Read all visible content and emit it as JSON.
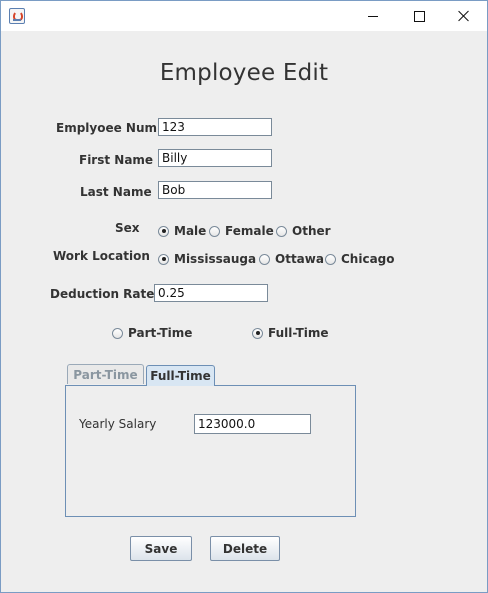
{
  "window": {
    "icon": "java-icon",
    "controls": {
      "minimize": "minimize-icon",
      "maximize": "maximize-icon",
      "close": "close-icon"
    }
  },
  "form": {
    "title": "Employee Edit",
    "employee_num": {
      "label": "Emplyoee Num",
      "value": "123"
    },
    "first_name": {
      "label": "First Name",
      "value": "Billy"
    },
    "last_name": {
      "label": "Last Name",
      "value": "Bob"
    },
    "sex": {
      "label": "Sex",
      "options": [
        "Male",
        "Female",
        "Other"
      ],
      "selected": "Male"
    },
    "work_location": {
      "label": "Work Location",
      "options": [
        "Mississauga",
        "Ottawa",
        "Chicago"
      ],
      "selected": "Mississauga"
    },
    "deduction_rate": {
      "label": "Deduction Rate",
      "value": "0.25"
    },
    "employment_type": {
      "options": [
        "Part-Time",
        "Full-Time"
      ],
      "selected": "Full-Time"
    },
    "tabs": [
      {
        "label": "Part-Time",
        "active": false
      },
      {
        "label": "Full-Time",
        "active": true
      }
    ],
    "yearly_salary": {
      "label": "Yearly Salary",
      "value": "123000.0"
    },
    "buttons": {
      "save": "Save",
      "delete": "Delete"
    }
  },
  "colors": {
    "background": "#eeeeee",
    "tab_active": "#d8e6f3",
    "border_accent": "#6d8fb5"
  }
}
